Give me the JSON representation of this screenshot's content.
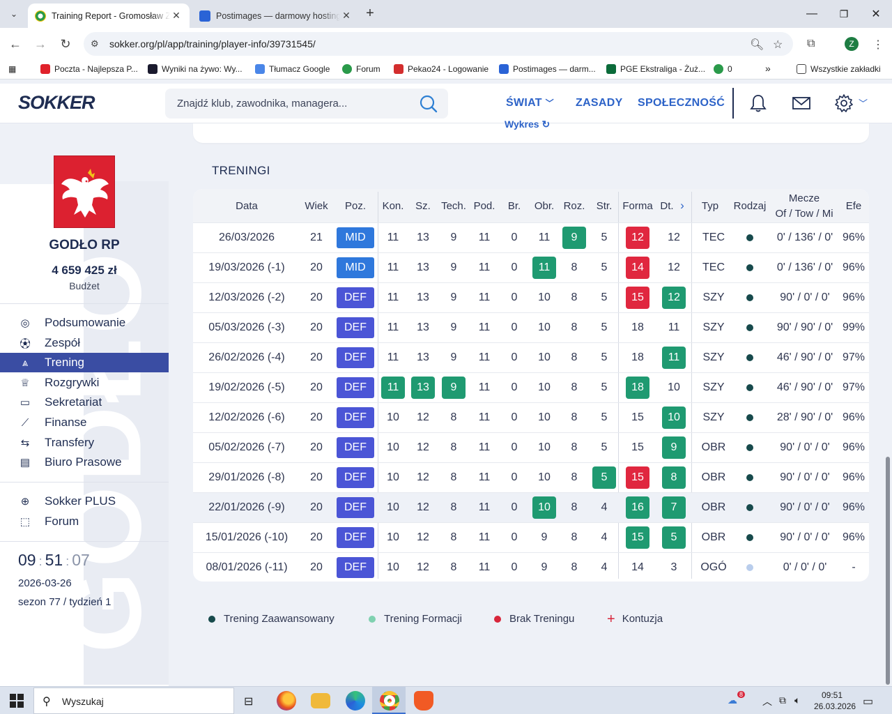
{
  "browser": {
    "tabs": [
      {
        "title": "Training Report - Gromosław Zg",
        "active": true
      },
      {
        "title": "Postimages — darmowy hosting",
        "active": false
      }
    ],
    "url": "sokker.org/pl/app/training/player-info/39731545/",
    "profile_initial": "Z",
    "bookmarks": [
      "Poczta - Najlepsza P...",
      "Wyniki na żywo: Wy...",
      "Tłumacz Google",
      "Forum",
      "Pekao24 - Logowanie",
      "Postimages — darm...",
      "PGE Ekstraliga - Żuż...",
      "0"
    ],
    "all_bookmarks": "Wszystkie zakładki"
  },
  "header": {
    "logo": "SOKKER",
    "search_placeholder": "Znajdź klub, zawodnika, managera...",
    "menu": [
      "ŚWIAT",
      "ZASADY",
      "SPOŁECZNOŚĆ"
    ]
  },
  "sidebar": {
    "club_name": "GODŁO RP",
    "budget": "4 659 425 zł",
    "budget_label": "Budżet",
    "watermark": "GODŁO",
    "nav": [
      {
        "label": "Podsumowanie",
        "icon": "summary-icon"
      },
      {
        "label": "Zespół",
        "icon": "ball-icon"
      },
      {
        "label": "Trening",
        "icon": "training-icon",
        "active": true
      },
      {
        "label": "Rozgrywki",
        "icon": "trophy-icon"
      },
      {
        "label": "Sekretariat",
        "icon": "office-icon"
      },
      {
        "label": "Finanse",
        "icon": "chart-icon"
      },
      {
        "label": "Transfery",
        "icon": "transfer-icon"
      },
      {
        "label": "Biuro Prasowe",
        "icon": "press-icon"
      }
    ],
    "extra": [
      {
        "label": "Sokker PLUS",
        "icon": "plus-circle-icon"
      },
      {
        "label": "Forum",
        "icon": "forum-icon"
      }
    ],
    "clock": {
      "h": "09",
      "m": "51",
      "s": "07"
    },
    "date": "2026-03-26",
    "season": "sezon 77 / tydzień 1"
  },
  "main": {
    "partial_link": "Wykres",
    "section_title": "TRENINGI",
    "columns": [
      "Data",
      "Wiek",
      "Poz.",
      "Kon.",
      "Sz.",
      "Tech.",
      "Pod.",
      "Br.",
      "Obr.",
      "Roz.",
      "Str.",
      "Forma",
      "Dt.",
      "Typ",
      "Rodzaj",
      "Mecze",
      "Of / Tow / Mi",
      "Efe"
    ],
    "rows": [
      {
        "date": "26/03/2026",
        "age": "21",
        "pos": "MID",
        "kon": "11",
        "sz": "13",
        "tech": "9",
        "pod": "11",
        "br": "0",
        "obr": "11",
        "roz": "9",
        "str": "5",
        "forma": "12",
        "dt": "12",
        "typ": "TEC",
        "rodzaj": "dark",
        "mecze": "0' / 136' / 0'",
        "efe": "96%",
        "hl": {
          "roz": "green",
          "forma": "red"
        }
      },
      {
        "date": "19/03/2026 (-1)",
        "age": "20",
        "pos": "MID",
        "kon": "11",
        "sz": "13",
        "tech": "9",
        "pod": "11",
        "br": "0",
        "obr": "11",
        "roz": "8",
        "str": "5",
        "forma": "14",
        "dt": "12",
        "typ": "TEC",
        "rodzaj": "dark",
        "mecze": "0' / 136' / 0'",
        "efe": "96%",
        "hl": {
          "obr": "green",
          "forma": "red"
        }
      },
      {
        "date": "12/03/2026 (-2)",
        "age": "20",
        "pos": "DEF",
        "kon": "11",
        "sz": "13",
        "tech": "9",
        "pod": "11",
        "br": "0",
        "obr": "10",
        "roz": "8",
        "str": "5",
        "forma": "15",
        "dt": "12",
        "typ": "SZY",
        "rodzaj": "dark",
        "mecze": "90' / 0' / 0'",
        "efe": "96%",
        "hl": {
          "forma": "red",
          "dt": "green"
        }
      },
      {
        "date": "05/03/2026 (-3)",
        "age": "20",
        "pos": "DEF",
        "kon": "11",
        "sz": "13",
        "tech": "9",
        "pod": "11",
        "br": "0",
        "obr": "10",
        "roz": "8",
        "str": "5",
        "forma": "18",
        "dt": "11",
        "typ": "SZY",
        "rodzaj": "dark",
        "mecze": "90' / 90' / 0'",
        "efe": "99%",
        "hl": {}
      },
      {
        "date": "26/02/2026 (-4)",
        "age": "20",
        "pos": "DEF",
        "kon": "11",
        "sz": "13",
        "tech": "9",
        "pod": "11",
        "br": "0",
        "obr": "10",
        "roz": "8",
        "str": "5",
        "forma": "18",
        "dt": "11",
        "typ": "SZY",
        "rodzaj": "dark",
        "mecze": "46' / 90' / 0'",
        "efe": "97%",
        "hl": {
          "dt": "green"
        }
      },
      {
        "date": "19/02/2026 (-5)",
        "age": "20",
        "pos": "DEF",
        "kon": "11",
        "sz": "13",
        "tech": "9",
        "pod": "11",
        "br": "0",
        "obr": "10",
        "roz": "8",
        "str": "5",
        "forma": "18",
        "dt": "10",
        "typ": "SZY",
        "rodzaj": "dark",
        "mecze": "46' / 90' / 0'",
        "efe": "97%",
        "hl": {
          "kon": "green",
          "sz": "green",
          "tech": "green",
          "forma": "green"
        }
      },
      {
        "date": "12/02/2026 (-6)",
        "age": "20",
        "pos": "DEF",
        "kon": "10",
        "sz": "12",
        "tech": "8",
        "pod": "11",
        "br": "0",
        "obr": "10",
        "roz": "8",
        "str": "5",
        "forma": "15",
        "dt": "10",
        "typ": "SZY",
        "rodzaj": "dark",
        "mecze": "28' / 90' / 0'",
        "efe": "96%",
        "hl": {
          "dt": "green"
        }
      },
      {
        "date": "05/02/2026 (-7)",
        "age": "20",
        "pos": "DEF",
        "kon": "10",
        "sz": "12",
        "tech": "8",
        "pod": "11",
        "br": "0",
        "obr": "10",
        "roz": "8",
        "str": "5",
        "forma": "15",
        "dt": "9",
        "typ": "OBR",
        "rodzaj": "dark",
        "mecze": "90' / 0' / 0'",
        "efe": "96%",
        "hl": {
          "dt": "green"
        }
      },
      {
        "date": "29/01/2026 (-8)",
        "age": "20",
        "pos": "DEF",
        "kon": "10",
        "sz": "12",
        "tech": "8",
        "pod": "11",
        "br": "0",
        "obr": "10",
        "roz": "8",
        "str": "5",
        "forma": "15",
        "dt": "8",
        "typ": "OBR",
        "rodzaj": "dark",
        "mecze": "90' / 0' / 0'",
        "efe": "96%",
        "hl": {
          "str": "green",
          "forma": "red",
          "dt": "green"
        }
      },
      {
        "date": "22/01/2026 (-9)",
        "age": "20",
        "pos": "DEF",
        "kon": "10",
        "sz": "12",
        "tech": "8",
        "pod": "11",
        "br": "0",
        "obr": "10",
        "roz": "8",
        "str": "4",
        "forma": "16",
        "dt": "7",
        "typ": "OBR",
        "rodzaj": "dark",
        "mecze": "90' / 0' / 0'",
        "efe": "96%",
        "hl": {
          "obr": "green",
          "forma": "green",
          "dt": "green"
        },
        "row_hl": true
      },
      {
        "date": "15/01/2026 (-10)",
        "age": "20",
        "pos": "DEF",
        "kon": "10",
        "sz": "12",
        "tech": "8",
        "pod": "11",
        "br": "0",
        "obr": "9",
        "roz": "8",
        "str": "4",
        "forma": "15",
        "dt": "5",
        "typ": "OBR",
        "rodzaj": "dark",
        "mecze": "90' / 0' / 0'",
        "efe": "96%",
        "hl": {
          "forma": "green",
          "dt": "green"
        }
      },
      {
        "date": "08/01/2026 (-11)",
        "age": "20",
        "pos": "DEF",
        "kon": "10",
        "sz": "12",
        "tech": "8",
        "pod": "11",
        "br": "0",
        "obr": "9",
        "roz": "8",
        "str": "4",
        "forma": "14",
        "dt": "3",
        "typ": "OGÓ",
        "rodzaj": "light",
        "mecze": "0' / 0' / 0'",
        "efe": "-",
        "hl": {}
      }
    ],
    "legend": [
      {
        "label": "Trening Zaawansowany",
        "color": "#174a4c"
      },
      {
        "label": "Trening Formacji",
        "color": "#7fd1b0"
      },
      {
        "label": "Brak Treningu",
        "color": "#d8263b"
      },
      {
        "label": "Kontuzja",
        "color": "#d8263b"
      }
    ]
  },
  "taskbar": {
    "search": "Wyszukaj",
    "time": "09:51",
    "date": "26.03.2026",
    "badge": "8"
  }
}
